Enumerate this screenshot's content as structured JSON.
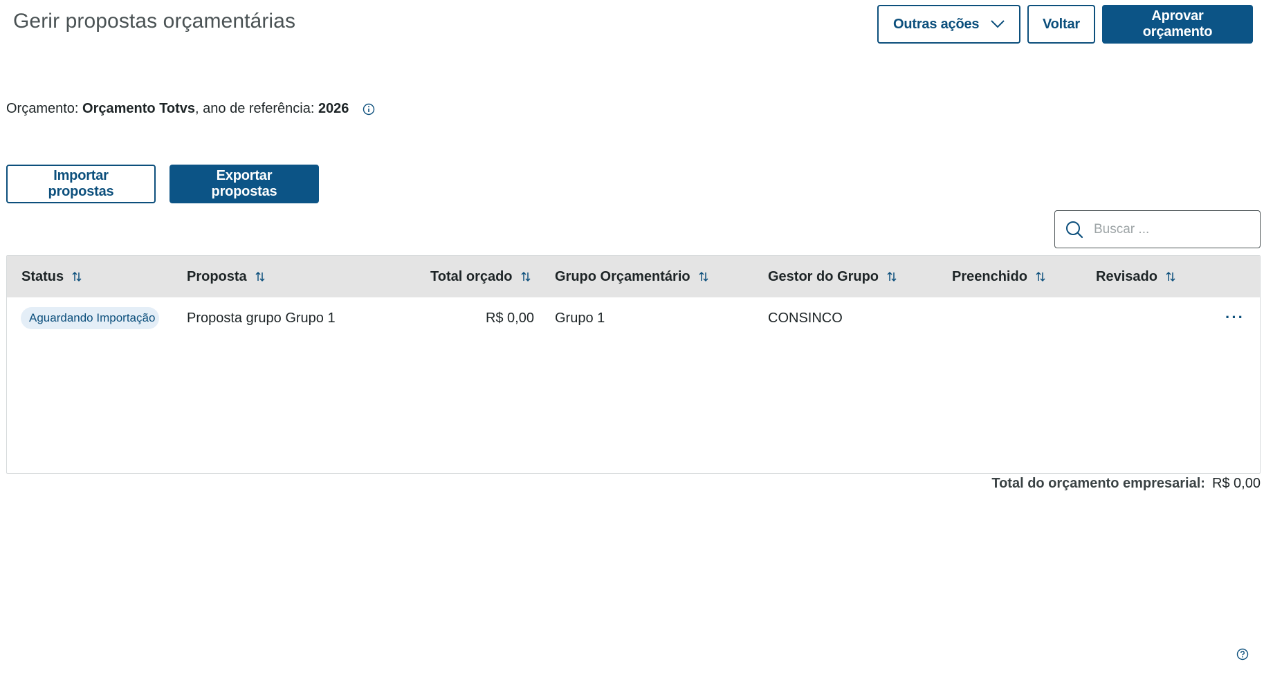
{
  "header": {
    "title": "Gerir propostas orçamentárias",
    "outras_acoes_label": "Outras ações",
    "voltar_label": "Voltar",
    "aprovar_label": "Aprovar orçamento"
  },
  "info": {
    "orcamento_prefix": "Orçamento: ",
    "orcamento_name": "Orçamento Totvs",
    "ano_prefix": ", ano de referência: ",
    "ano_value": "2026"
  },
  "actions": {
    "import_label": "Importar propostas",
    "export_label": "Exportar propostas"
  },
  "search": {
    "placeholder": "Buscar ..."
  },
  "table": {
    "columns": [
      "Status",
      "Proposta",
      "Total orçado",
      "Grupo Orçamentário",
      "Gestor do Grupo",
      "Preenchido",
      "Revisado"
    ],
    "rows": [
      {
        "status": "Aguardando Importação",
        "proposta": "Proposta grupo Grupo 1",
        "total": "R$ 0,00",
        "grupo": "Grupo 1",
        "gestor": "CONSINCO",
        "preenchido": "",
        "revisado": "",
        "more": "···"
      }
    ]
  },
  "footer": {
    "total_label": "Total do orçamento empresarial:",
    "total_value": "R$ 0,00"
  },
  "icons": {
    "dropdown": "chevron-down-icon",
    "info": "info-icon",
    "search": "search-icon",
    "sort": "sort-icon",
    "more": "more-options-icon",
    "help": "help-icon"
  },
  "colors": {
    "primary": "#0c5486",
    "header_bg": "#e4e4e4",
    "tag_bg": "#e4eef7"
  }
}
